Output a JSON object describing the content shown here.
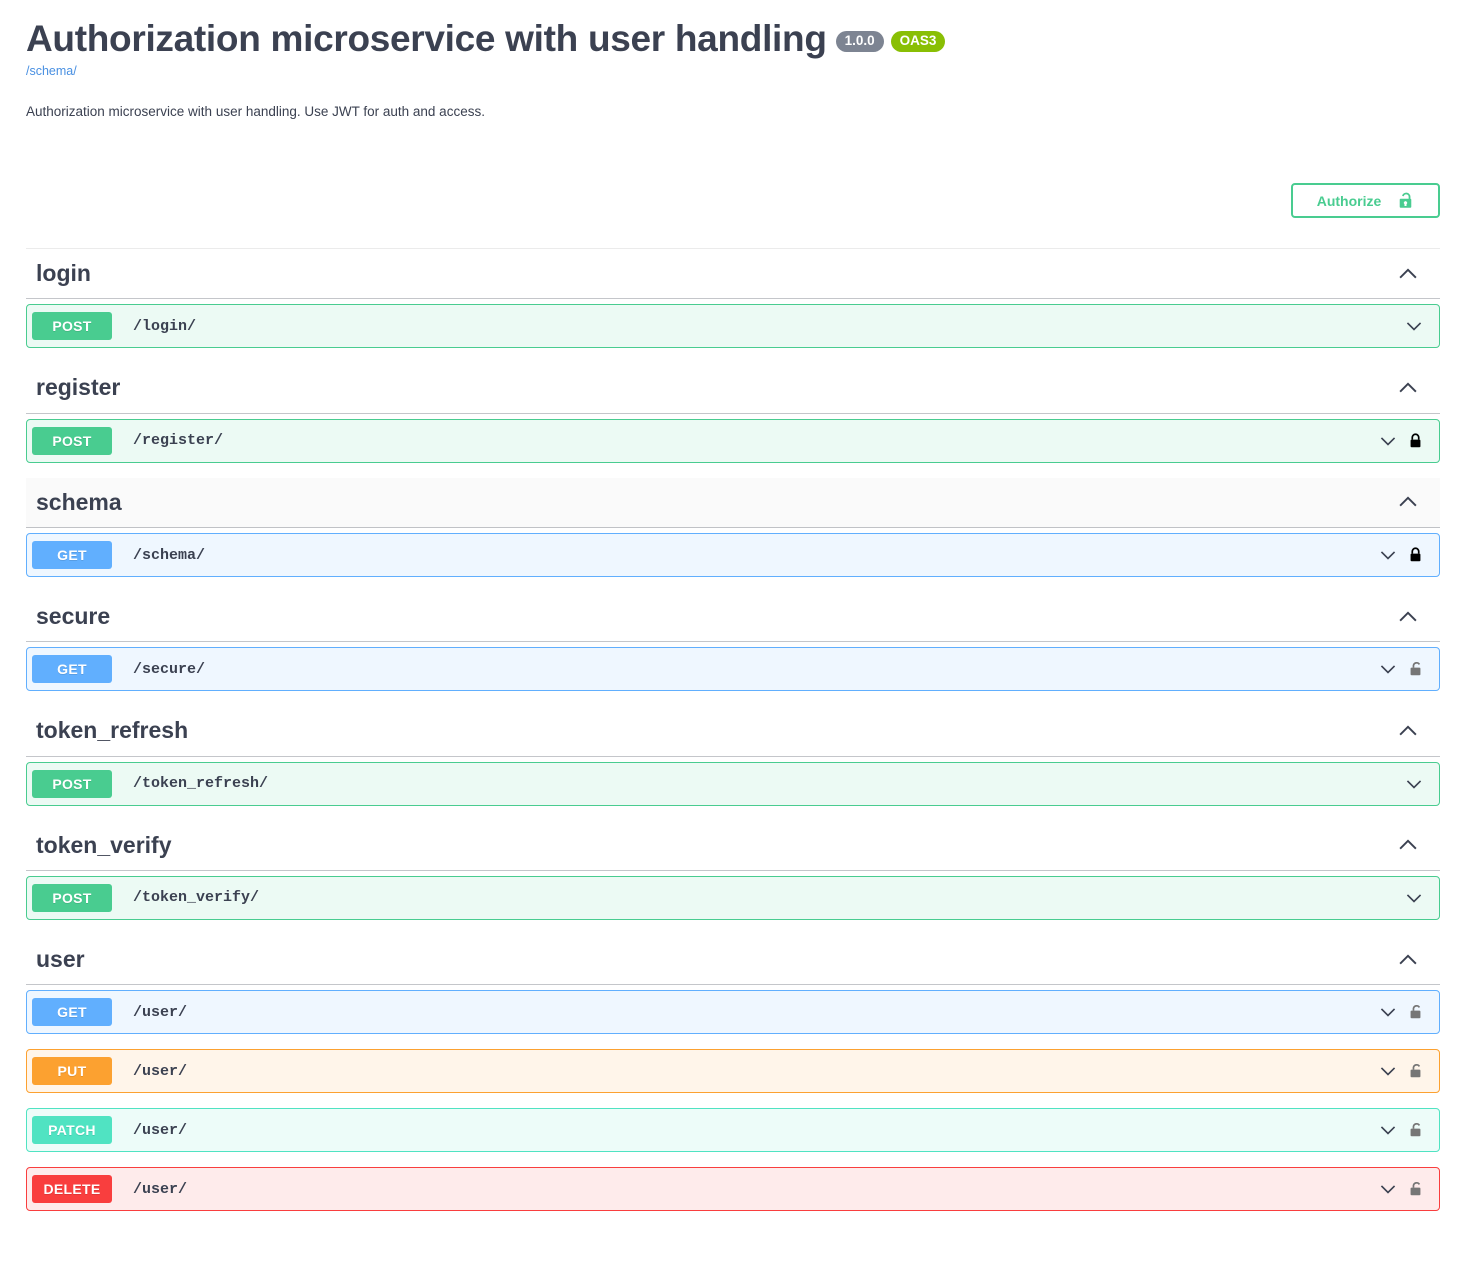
{
  "info": {
    "title": "Authorization microservice with user handling",
    "version_badge": "1.0.0",
    "spec_badge": "OAS3",
    "url": "/schema/",
    "description": "Authorization microservice with user handling. Use JWT for auth and access."
  },
  "auth": {
    "authorize_label": "Authorize",
    "lock_state": "unlocked"
  },
  "colors": {
    "get": "#61affe",
    "post": "#49cc90",
    "put": "#fca130",
    "patch": "#50e3c2",
    "delete": "#f93e3e",
    "oas_badge": "#89bf04",
    "version_badge": "#7d8492",
    "link": "#4990e2",
    "text": "#3b4151"
  },
  "sections": [
    {
      "tag": "login",
      "expanded": true,
      "hovered": false,
      "operations": [
        {
          "method": "POST",
          "method_class": "post",
          "path": "/login/",
          "lock": "none"
        }
      ]
    },
    {
      "tag": "register",
      "expanded": true,
      "hovered": false,
      "operations": [
        {
          "method": "POST",
          "method_class": "post",
          "path": "/register/",
          "lock": "locked"
        }
      ]
    },
    {
      "tag": "schema",
      "expanded": true,
      "hovered": true,
      "operations": [
        {
          "method": "GET",
          "method_class": "get",
          "path": "/schema/",
          "lock": "locked"
        }
      ]
    },
    {
      "tag": "secure",
      "expanded": true,
      "hovered": false,
      "operations": [
        {
          "method": "GET",
          "method_class": "get",
          "path": "/secure/",
          "lock": "unlocked"
        }
      ]
    },
    {
      "tag": "token_refresh",
      "expanded": true,
      "hovered": false,
      "operations": [
        {
          "method": "POST",
          "method_class": "post",
          "path": "/token_refresh/",
          "lock": "none"
        }
      ]
    },
    {
      "tag": "token_verify",
      "expanded": true,
      "hovered": false,
      "operations": [
        {
          "method": "POST",
          "method_class": "post",
          "path": "/token_verify/",
          "lock": "none"
        }
      ]
    },
    {
      "tag": "user",
      "expanded": true,
      "hovered": false,
      "operations": [
        {
          "method": "GET",
          "method_class": "get",
          "path": "/user/",
          "lock": "unlocked"
        },
        {
          "method": "PUT",
          "method_class": "put",
          "path": "/user/",
          "lock": "unlocked"
        },
        {
          "method": "PATCH",
          "method_class": "patch",
          "path": "/user/",
          "lock": "unlocked"
        },
        {
          "method": "DELETE",
          "method_class": "delete",
          "path": "/user/",
          "lock": "unlocked"
        }
      ]
    }
  ]
}
